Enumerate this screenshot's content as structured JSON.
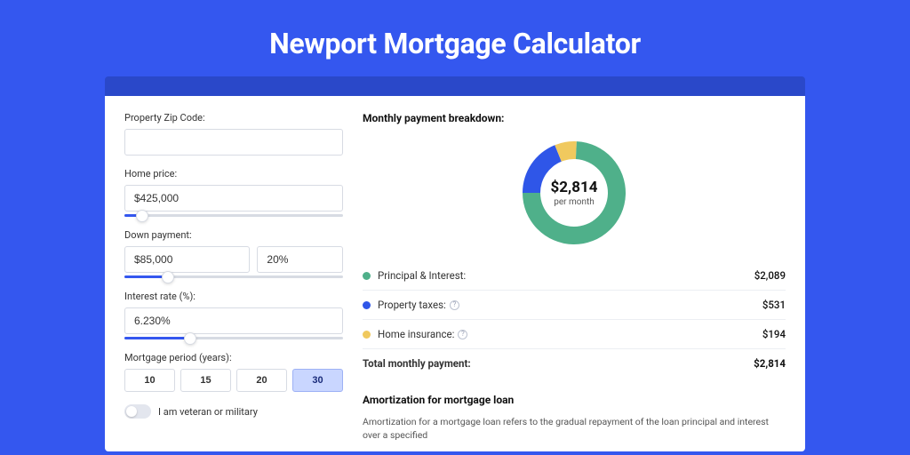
{
  "hero": {
    "title": "Newport Mortgage Calculator"
  },
  "form": {
    "zip_label": "Property Zip Code:",
    "zip_value": "",
    "price_label": "Home price:",
    "price_value": "$425,000",
    "price_slider_pct": 8,
    "down_label": "Down payment:",
    "down_value": "$85,000",
    "down_pct": "20%",
    "down_slider_pct": 20,
    "rate_label": "Interest rate (%):",
    "rate_value": "6.230%",
    "rate_slider_pct": 30,
    "period_label": "Mortgage period (years):",
    "periods": [
      "10",
      "15",
      "20",
      "30"
    ],
    "period_active": "30",
    "vet_label": "I am veteran or military",
    "vet_on": false
  },
  "breakdown": {
    "title": "Monthly payment breakdown:",
    "center_value": "$2,814",
    "center_sub": "per month",
    "items": [
      {
        "label": "Principal & Interest:",
        "value": "$2,089",
        "color": "#4fb08a",
        "info": false,
        "pct": 74.2
      },
      {
        "label": "Property taxes:",
        "value": "$531",
        "color": "#2f56e8",
        "info": true,
        "pct": 18.9
      },
      {
        "label": "Home insurance:",
        "value": "$194",
        "color": "#f0c95e",
        "info": true,
        "pct": 6.9
      }
    ],
    "total_label": "Total monthly payment:",
    "total_value": "$2,814"
  },
  "amort": {
    "title": "Amortization for mortgage loan",
    "body": "Amortization for a mortgage loan refers to the gradual repayment of the loan principal and interest over a specified"
  },
  "chart_data": {
    "type": "pie",
    "title": "Monthly payment breakdown",
    "series": [
      {
        "name": "Principal & Interest",
        "value": 2089,
        "color": "#4fb08a"
      },
      {
        "name": "Property taxes",
        "value": 531,
        "color": "#2f56e8"
      },
      {
        "name": "Home insurance",
        "value": 194,
        "color": "#f0c95e"
      }
    ],
    "total": 2814,
    "center_label": "$2,814 per month"
  }
}
